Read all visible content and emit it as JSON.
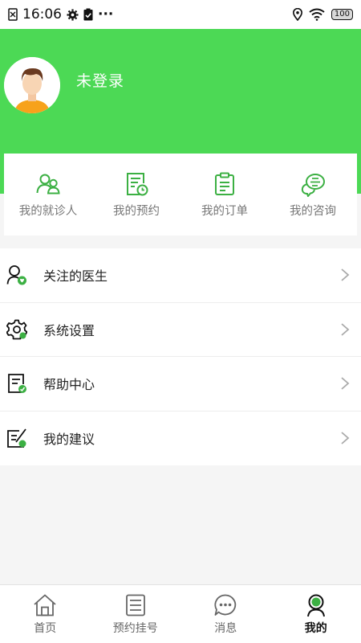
{
  "status_bar": {
    "time": "16:06",
    "dots": "···",
    "battery": "100"
  },
  "profile": {
    "login_text": "未登录"
  },
  "quick_actions": [
    {
      "label": "我的就诊人",
      "icon": "patients-icon"
    },
    {
      "label": "我的预约",
      "icon": "appointment-icon"
    },
    {
      "label": "我的订单",
      "icon": "orders-icon"
    },
    {
      "label": "我的咨询",
      "icon": "consult-icon"
    }
  ],
  "menu": [
    {
      "label": "关注的医生",
      "icon": "followed-doctor-icon"
    },
    {
      "label": "系统设置",
      "icon": "settings-icon"
    },
    {
      "label": "帮助中心",
      "icon": "help-icon"
    },
    {
      "label": "我的建议",
      "icon": "suggestion-icon"
    }
  ],
  "tabbar": [
    {
      "label": "首页",
      "icon": "home-icon"
    },
    {
      "label": "预约挂号",
      "icon": "register-icon"
    },
    {
      "label": "消息",
      "icon": "message-icon"
    },
    {
      "label": "我的",
      "icon": "profile-icon",
      "active": true
    }
  ],
  "colors": {
    "brand_green": "#4cd955",
    "icon_green": "#3cb043"
  }
}
